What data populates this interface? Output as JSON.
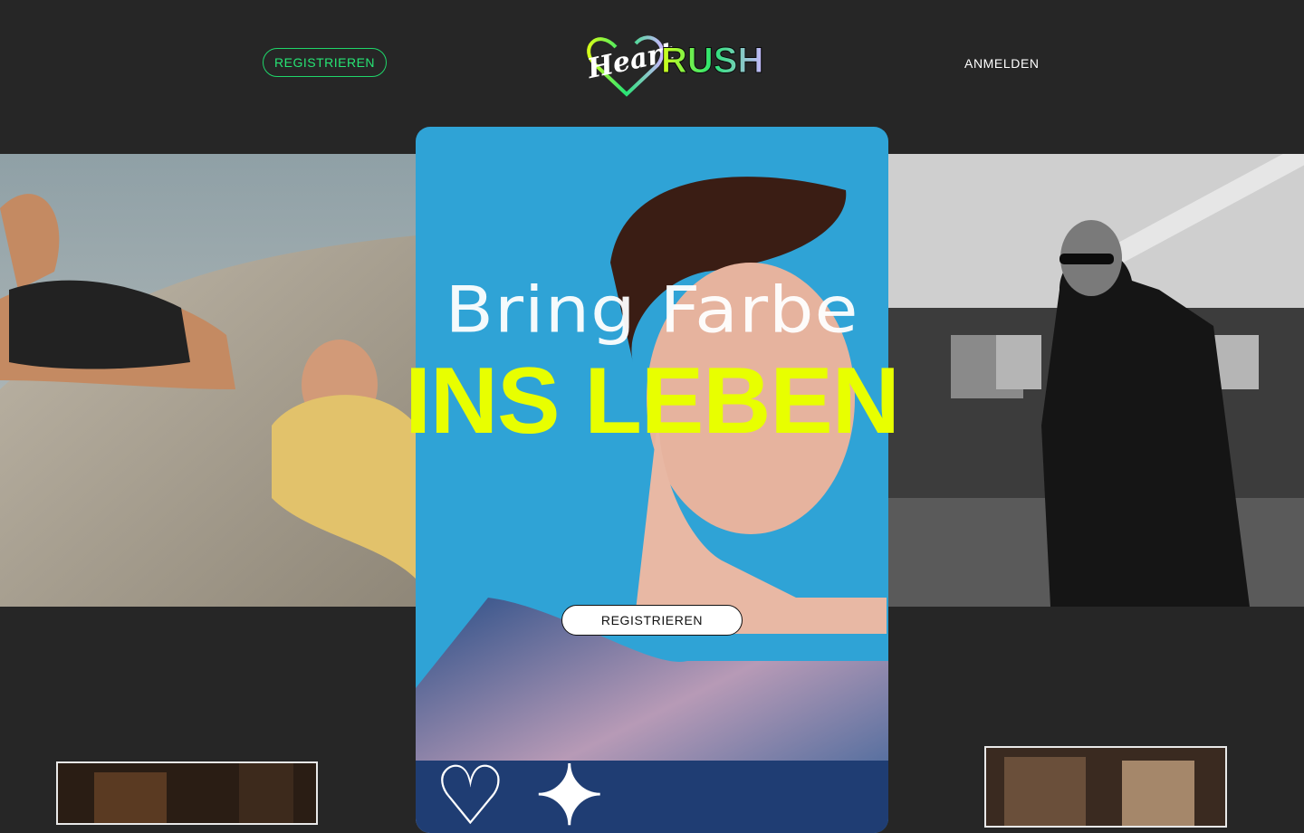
{
  "header": {
    "register_label": "REGISTRIEREN",
    "login_label": "ANMELDEN",
    "logo": {
      "script_text": "Heart",
      "bold_text": "RUSH"
    }
  },
  "hero": {
    "headline_thin": "Bring Farbe",
    "headline_bold": "INS LEBEN",
    "cta_label": "REGISTRIEREN"
  },
  "colors": {
    "accent_green": "#1fd66a",
    "accent_yellow": "#e8ff00",
    "hero_blue": "#2fa3d6",
    "background": "#262626"
  },
  "icons": [
    "heartrush-logo"
  ]
}
